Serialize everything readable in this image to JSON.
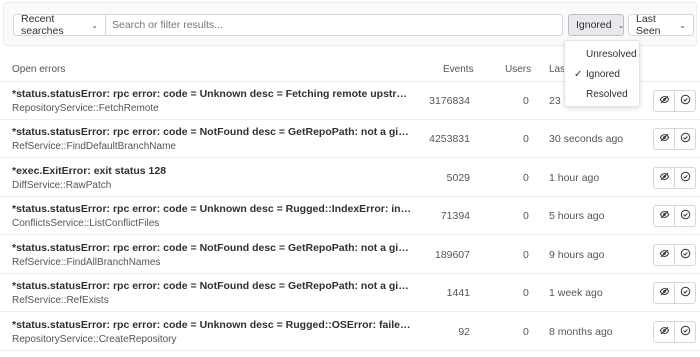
{
  "filters": {
    "recent_searches_label": "Recent searches",
    "search_placeholder": "Search or filter results...",
    "status_label": "Ignored",
    "sort_label": "Last Seen"
  },
  "status_dropdown": {
    "options": [
      {
        "label": "Unresolved",
        "checked": false
      },
      {
        "label": "Ignored",
        "checked": true
      },
      {
        "label": "Resolved",
        "checked": false
      }
    ]
  },
  "table": {
    "headers": {
      "title": "Open errors",
      "events": "Events",
      "users": "Users",
      "last_seen": "Last"
    },
    "rows": [
      {
        "title": "*status.statusError: rpc error: code = Unknown desc = Fetching remote upstream failed: fatal:...",
        "subtitle": "RepositoryService::FetchRemote",
        "events": "3176834",
        "users": "0",
        "last_seen": "23 s",
        "actions": true
      },
      {
        "title": "*status.statusError: rpc error: code = NotFound desc = GetRepoPath: not a git repository '/var...",
        "subtitle": "RefService::FindDefaultBranchName",
        "events": "4253831",
        "users": "0",
        "last_seen": "30 seconds ago",
        "actions": true
      },
      {
        "title": "*exec.ExitError: exit status 128",
        "subtitle": "DiffService::RawPatch",
        "events": "5029",
        "users": "0",
        "last_seen": "1 hour ago",
        "actions": true
      },
      {
        "title": "*status.statusError: rpc error: code = Unknown desc = Rugged::IndexError: invalid data in ind...",
        "subtitle": "ConflictsService::ListConflictFiles",
        "events": "71394",
        "users": "0",
        "last_seen": "5 hours ago",
        "actions": true
      },
      {
        "title": "*status.statusError: rpc error: code = NotFound desc = GetRepoPath: not a git repository '/var...",
        "subtitle": "RefService::FindAllBranchNames",
        "events": "189607",
        "users": "0",
        "last_seen": "9 hours ago",
        "actions": true
      },
      {
        "title": "*status.statusError: rpc error: code = NotFound desc = GetRepoPath: not a git repository '/var...",
        "subtitle": "RefService::RefExists",
        "events": "1441",
        "users": "0",
        "last_seen": "1 week ago",
        "actions": true
      },
      {
        "title": "*status.statusError: rpc error: code = Unknown desc = Rugged::OSError: failed to create locke...",
        "subtitle": "RepositoryService::CreateRepository",
        "events": "92",
        "users": "0",
        "last_seen": "8 months ago",
        "actions": true
      }
    ]
  },
  "icons": {
    "chevron": "chevron-down-icon",
    "check": "check-icon",
    "unignore": "eye-slash-icon",
    "resolve": "check-circle-icon"
  }
}
